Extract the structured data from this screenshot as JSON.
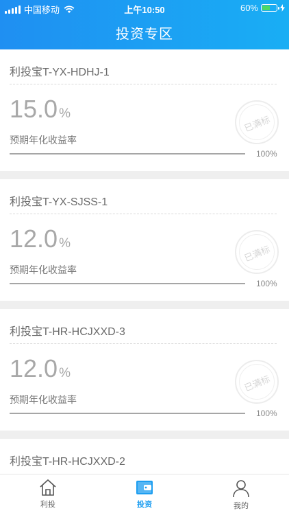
{
  "status_bar": {
    "carrier": "中国移动",
    "time": "上午10:50",
    "battery": "60%",
    "battery_level": 0.6
  },
  "header": {
    "title": "投资专区"
  },
  "products": [
    {
      "name": "利投宝T-YX-HDHJ-1",
      "rate": "15.0",
      "rate_unit": "%",
      "rate_label": "预期年化收益率",
      "progress": 100,
      "progress_text": "100%",
      "stamp": "已满标"
    },
    {
      "name": "利投宝T-YX-SJSS-1",
      "rate": "12.0",
      "rate_unit": "%",
      "rate_label": "预期年化收益率",
      "progress": 100,
      "progress_text": "100%",
      "stamp": "已满标"
    },
    {
      "name": "利投宝T-HR-HCJXXD-3",
      "rate": "12.0",
      "rate_unit": "%",
      "rate_label": "预期年化收益率",
      "progress": 100,
      "progress_text": "100%",
      "stamp": "已满标"
    },
    {
      "name": "利投宝T-HR-HCJXXD-2"
    }
  ],
  "tabbar": {
    "items": [
      {
        "label": "利投",
        "icon": "home-icon"
      },
      {
        "label": "投资",
        "icon": "wallet-icon",
        "active": true
      },
      {
        "label": "我的",
        "icon": "user-icon"
      }
    ]
  },
  "colors": {
    "header_start": "#1f8ff2",
    "header_end": "#19aef4",
    "active_tab": "#1e9ef0"
  }
}
